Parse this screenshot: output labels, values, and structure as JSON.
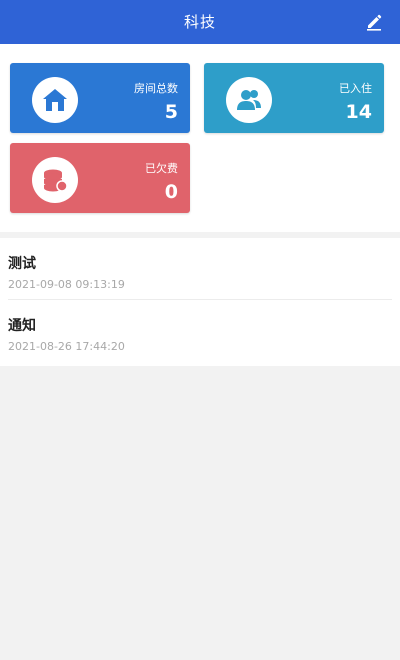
{
  "header": {
    "title": "科技",
    "action_icon": "edit-icon",
    "background": "#2f63d6"
  },
  "stats": [
    {
      "label": "房间总数",
      "value": "5",
      "icon": "home-icon",
      "color": "#2b78d4"
    },
    {
      "label": "已入住",
      "value": "14",
      "icon": "users-icon",
      "color": "#2e9ec9"
    },
    {
      "label": "已欠费",
      "value": "0",
      "icon": "coins-icon",
      "color": "#e0636b"
    }
  ],
  "notices": [
    {
      "title": "测试",
      "time": "2021-09-08 09:13:19"
    },
    {
      "title": "通知",
      "time": "2021-08-26 17:44:20"
    }
  ]
}
